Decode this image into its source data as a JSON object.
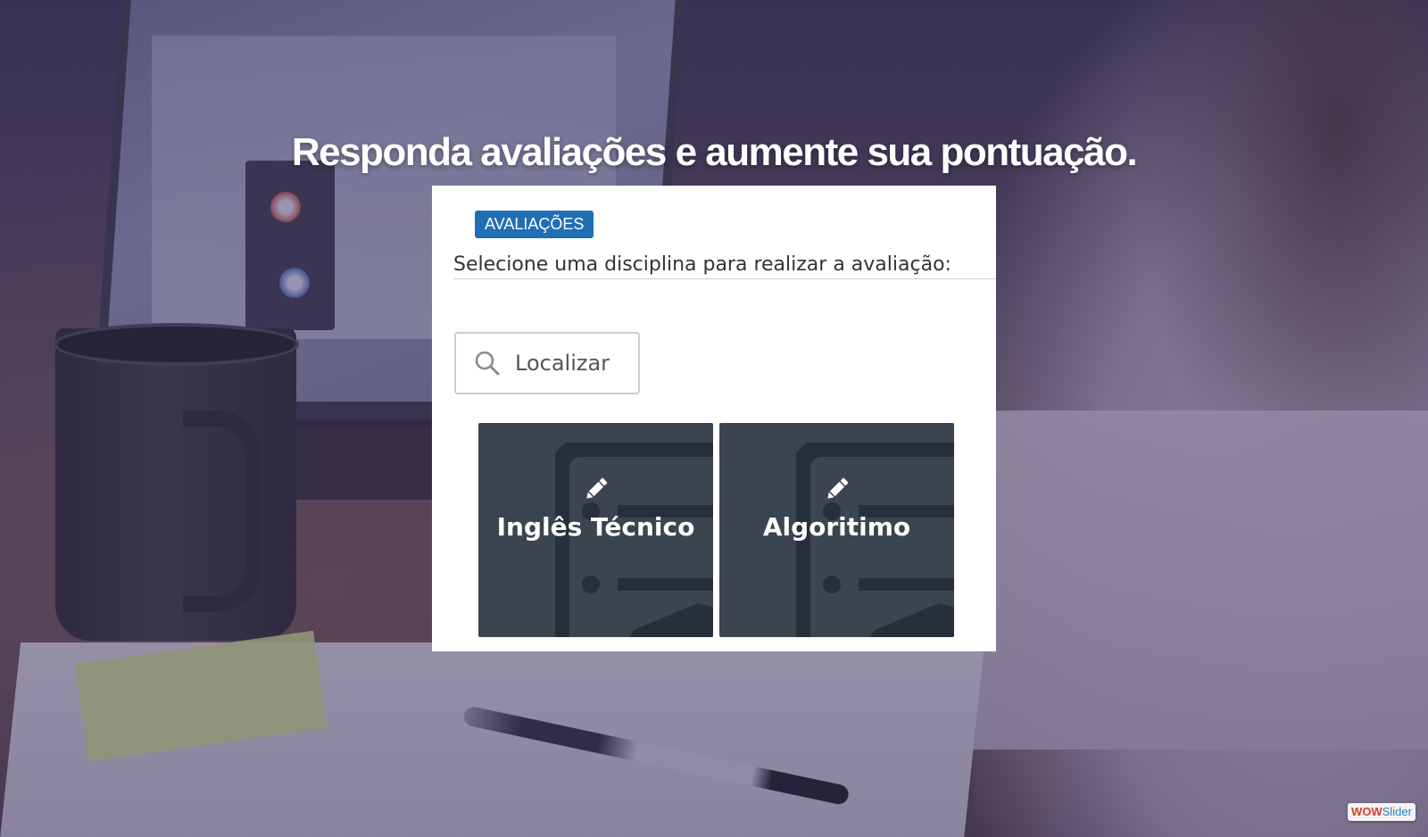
{
  "headline": "Responda avaliações e aumente sua pontuação.",
  "card": {
    "badge": "AVALIAÇÕES",
    "instruction": "Selecione uma disciplina para realizar a avaliação:",
    "search": {
      "placeholder": "Localizar",
      "value": ""
    },
    "subjects": [
      {
        "label": "Inglês Técnico",
        "icon": "pencil-icon"
      },
      {
        "label": "Algoritimo",
        "icon": "pencil-icon"
      }
    ]
  },
  "watermark": {
    "part1": "WOW",
    "part2": "Slider"
  },
  "colors": {
    "badge": "#1f6fb5",
    "tile": "#3a4550",
    "headline": "#ffffff"
  }
}
